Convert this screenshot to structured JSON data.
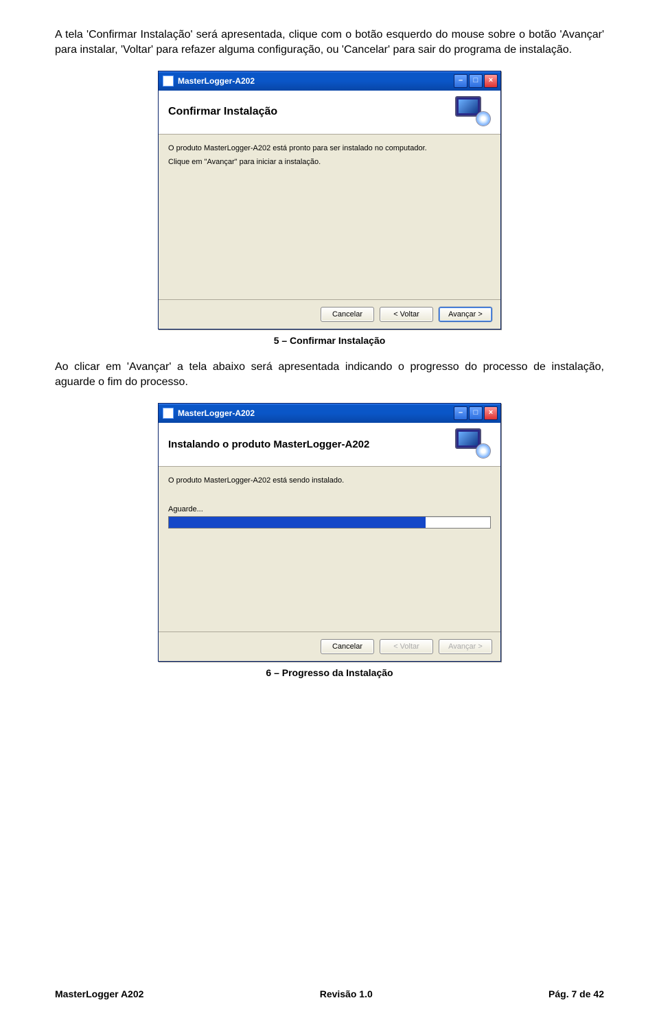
{
  "intro": {
    "p1": "A tela 'Confirmar Instalação' será apresentada, clique com o botão esquerdo do mouse sobre o botão 'Avançar' para instalar, 'Voltar' para refazer alguma configuração, ou 'Cancelar' para sair do programa de instalação."
  },
  "dialog1": {
    "window_title": "MasterLogger-A202",
    "banner_title": "Confirmar Instalação",
    "line1": "O produto MasterLogger-A202 está pronto para ser instalado no computador.",
    "line2": "Clique em \"Avançar\" para iniciar a instalação.",
    "buttons": {
      "cancel": "Cancelar",
      "back": "< Voltar",
      "next": "Avançar >"
    }
  },
  "caption1": "5 – Confirmar Instalação",
  "mid_text": "Ao clicar em 'Avançar' a tela abaixo será apresentada indicando o progresso do processo de instalação, aguarde o fim do processo.",
  "dialog2": {
    "window_title": "MasterLogger-A202",
    "banner_title": "Instalando o produto MasterLogger-A202",
    "line1": "O produto MasterLogger-A202 está sendo instalado.",
    "progress_label": "Aguarde...",
    "buttons": {
      "cancel": "Cancelar",
      "back": "< Voltar",
      "next": "Avançar >"
    }
  },
  "caption2": "6 – Progresso da Instalação",
  "footer": {
    "left": "MasterLogger A202",
    "center": "Revisão 1.0",
    "right": "Pág. 7 de 42"
  }
}
